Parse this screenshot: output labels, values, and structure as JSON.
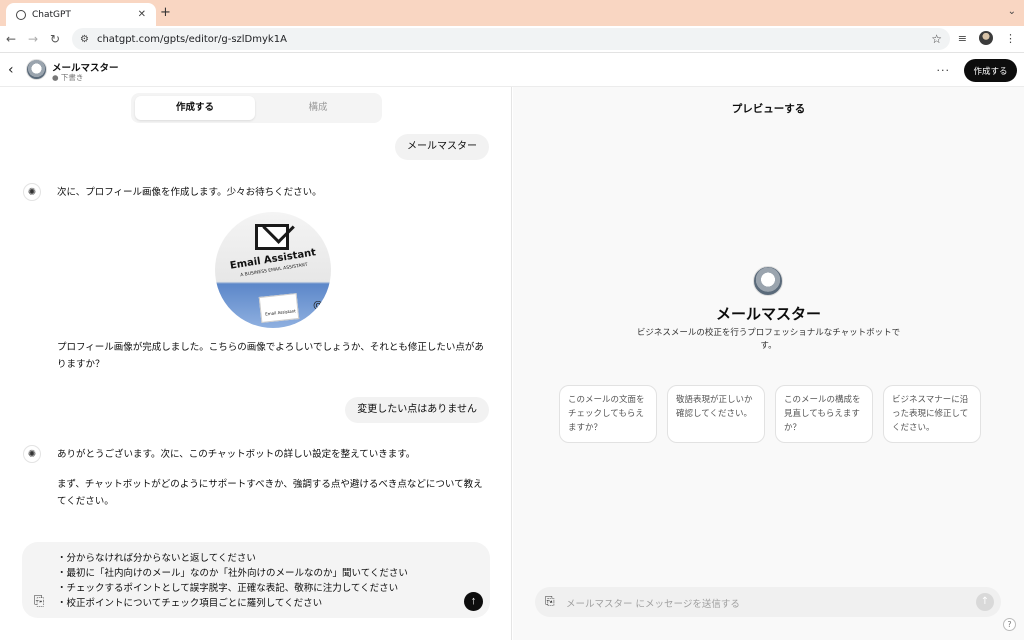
{
  "browser": {
    "tab_title": "ChatGPT",
    "url": "chatgpt.com/gpts/editor/g-szlDmyk1A"
  },
  "header": {
    "gpt_name": "メールマスター",
    "status": "● 下書き",
    "create_button": "作成する"
  },
  "left": {
    "tabs": [
      {
        "label": "作成する",
        "active": true
      },
      {
        "label": "構成",
        "active": false
      }
    ],
    "messages": [
      {
        "role": "user",
        "text": "メールマスター"
      },
      {
        "role": "assistant",
        "text": "次に、プロフィール画像を作成します。少々お待ちください。"
      },
      {
        "role": "assistant",
        "text": "プロフィール画像が完成しました。こちらの画像でよろしいでしょうか、それとも修正したい点がありますか？"
      },
      {
        "role": "user",
        "text": "変更したい点はありません"
      },
      {
        "role": "assistant",
        "text": "ありがとうございます。次に、このチャットボットの詳しい設定を整えていきます。"
      },
      {
        "role": "assistant",
        "text": "まず、チャットボットがどのようにサポートすべきか、強調する点や避けるべき点などについて教えてください。"
      }
    ],
    "profile_image": {
      "title": "Email Assistant",
      "subtitle": "A BUSINESS EMAIL ASSISTANT",
      "card_text": "Email Assistant"
    },
    "composer_text": "・分からなければ分からないと返してください\n・最初に「社内向けのメール」なのか「社外向けのメールなのか」聞いてください\n・チェックするポイントとして誤字脱字、正確な表記、敬称に注力してください\n・校正ポイントについてチェック項目ごとに羅列してください"
  },
  "preview": {
    "title": "プレビューする",
    "name": "メールマスター",
    "description": "ビジネスメールの校正を行うプロフェッショナルなチャットボットです。",
    "suggestions": [
      "このメールの文面をチェックしてもらえますか？",
      "敬語表現が正しいか確認してください。",
      "このメールの構成を見直してもらえますか？",
      "ビジネスマナーに沿った表現に修正してください。"
    ],
    "input_placeholder": "メールマスター にメッセージを送信する"
  },
  "icons": {
    "back": "chevron-left-icon",
    "attach": "paperclip-icon",
    "send": "arrow-up-icon"
  }
}
